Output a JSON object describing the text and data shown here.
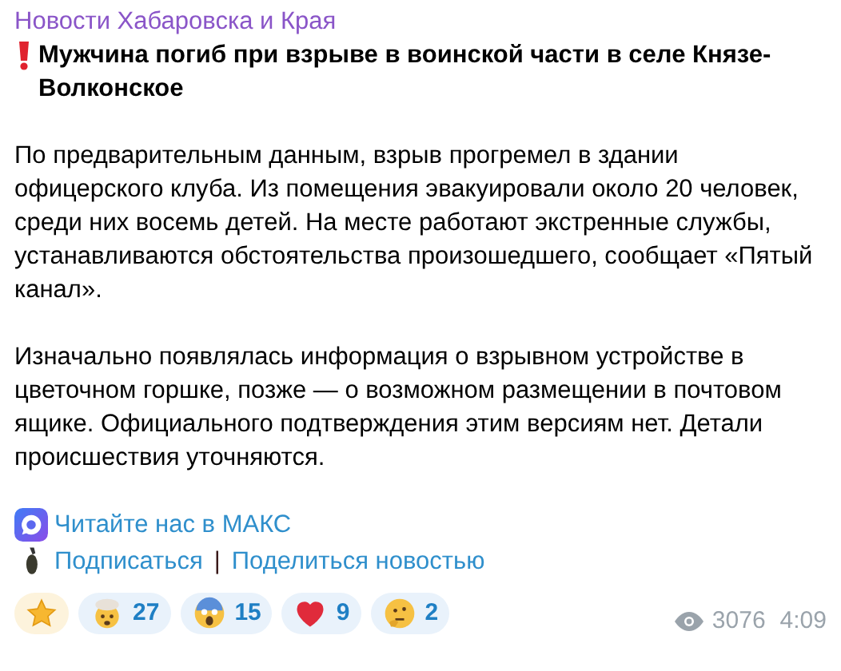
{
  "channel": {
    "name": "Новости Хабаровска и Края"
  },
  "post": {
    "headline": "Мужчина погиб при взрыве в воинской части в селе Князе-Волконское",
    "paragraphs": [
      "По предварительным данным, взрыв прогремел в здании офицерского клуба. Из помещения эвакуировали около 20 человек, среди них восемь детей. На месте работают экстренные службы, устанавливаются обстоятельства произошедшего, сообщает «Пятый канал».",
      "Изначально появлялась информация о взрывном устройстве в цветочном горшке, позже — о возможном размещении в почтовом ящике. Официального подтверждения этим версиям нет. Детали происшествия уточняются."
    ],
    "read_link": "Читайте нас в МАКС",
    "subscribe_link": "Подписаться",
    "separator": "|",
    "share_link": "Поделиться новостью"
  },
  "reactions": [
    {
      "kind": "star",
      "paid": true
    },
    {
      "kind": "exploding-head",
      "count": "27",
      "paid": false
    },
    {
      "kind": "scream",
      "count": "15",
      "paid": false
    },
    {
      "kind": "heart",
      "count": "9",
      "paid": false
    },
    {
      "kind": "thinking",
      "count": "2",
      "paid": false
    }
  ],
  "footer": {
    "views": "3076",
    "time": "4:09"
  }
}
